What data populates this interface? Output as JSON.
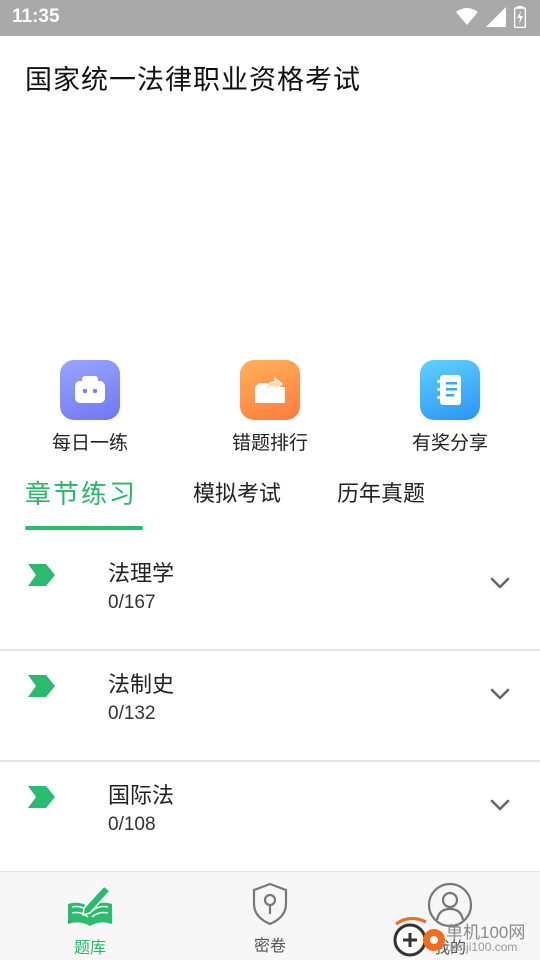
{
  "status_bar": {
    "time": "11:35",
    "icons": [
      "wifi-icon",
      "signal-icon",
      "battery-charging-icon"
    ]
  },
  "app": {
    "title": "国家统一法律职业资格考试"
  },
  "shortcuts": [
    {
      "label": "每日一练",
      "icon": "chat-bubble-icon",
      "color": "#7b84f5"
    },
    {
      "label": "错题排行",
      "icon": "folder-share-icon",
      "color": "#ff8a44"
    },
    {
      "label": "有奖分享",
      "icon": "notebook-icon",
      "color": "#3aa8f8"
    }
  ],
  "tabs": [
    {
      "label": "章节练习",
      "active": true
    },
    {
      "label": "模拟考试",
      "active": false
    },
    {
      "label": "历年真题",
      "active": false
    }
  ],
  "chapters": [
    {
      "name": "法理学",
      "progress": "0/167"
    },
    {
      "name": "法制史",
      "progress": "0/132"
    },
    {
      "name": "国际法",
      "progress": "0/108"
    }
  ],
  "bottom_nav": [
    {
      "label": "题库",
      "icon": "book-pen-icon",
      "active": true
    },
    {
      "label": "密卷",
      "icon": "shield-keyhole-icon",
      "active": false
    },
    {
      "label": "我的",
      "icon": "user-circle-icon",
      "active": false
    }
  ],
  "watermark": {
    "line1": "单机100网",
    "line2": "danji100.com"
  },
  "colors": {
    "accent": "#27b86a",
    "status_bar": "#a9a9a9",
    "divider": "#e3e3e3"
  }
}
